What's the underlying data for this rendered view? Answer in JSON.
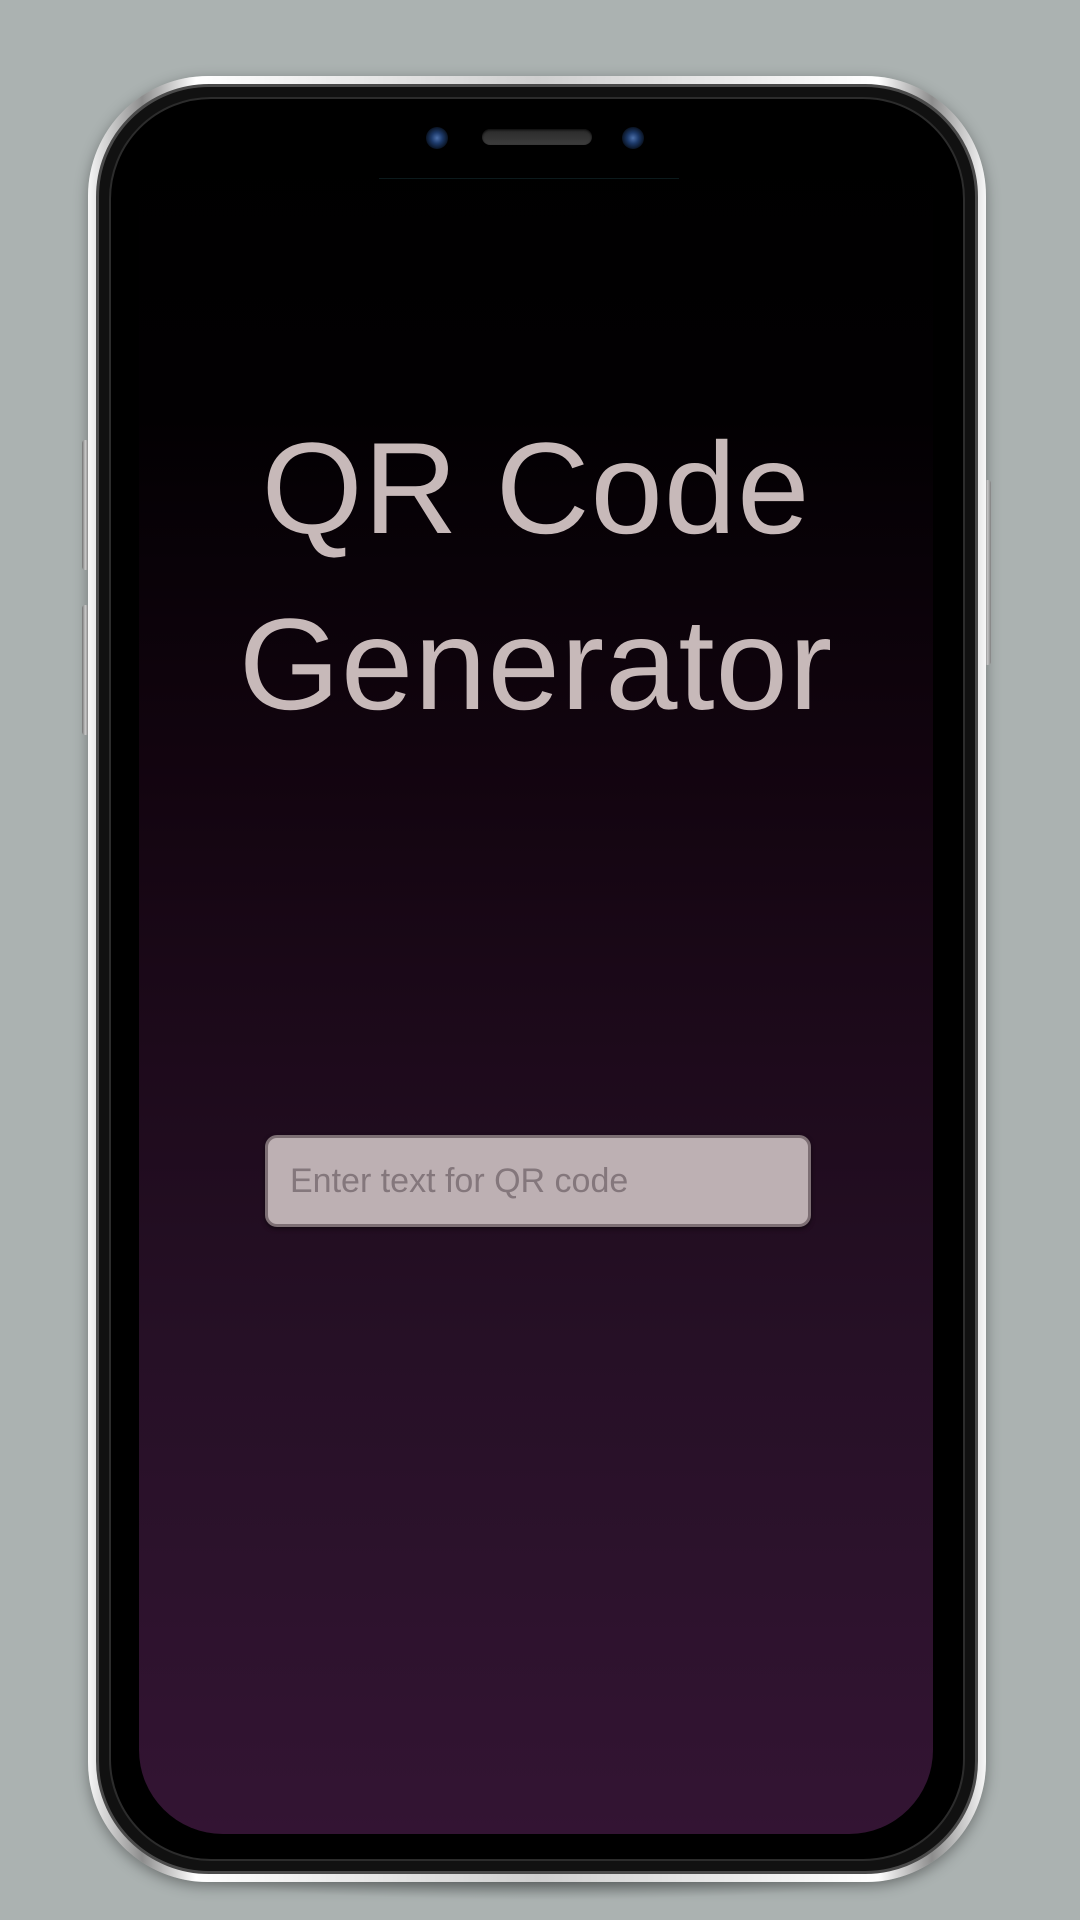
{
  "app": {
    "title_line1": "QR Code",
    "title_line2": "Generator"
  },
  "input": {
    "value": "",
    "placeholder": "Enter text for QR code"
  },
  "colors": {
    "page_background": "#abb2b1",
    "screen_gradient_top": "#000000",
    "screen_gradient_bottom": "#331433",
    "title_text": "#c7b9b9",
    "input_background": "#bdb0b3",
    "input_border": "#7d6f74",
    "placeholder_text": "#84777c"
  },
  "icons": {
    "front_camera": "camera-icon",
    "speaker": "speaker-grille"
  }
}
